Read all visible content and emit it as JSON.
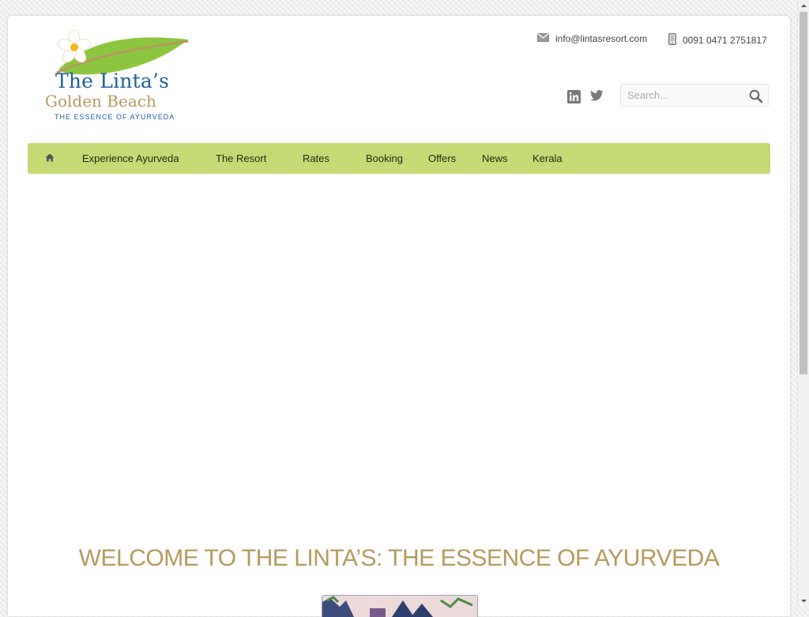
{
  "header": {
    "logo": {
      "line1": "The Linta’s",
      "line2": "Golden Beach",
      "line3": "THE ESSENCE OF AYURVEDA"
    },
    "contact": {
      "email": "info@lintasresort.com",
      "phone": "0091 0471 2751817"
    },
    "social": [
      "linkedin-icon",
      "twitter-icon"
    ],
    "search": {
      "placeholder": "Search..."
    }
  },
  "nav": {
    "home_icon": "home-icon",
    "items": [
      {
        "label": "Experience Ayurveda"
      },
      {
        "label": "The Resort"
      },
      {
        "label": "Rates"
      },
      {
        "label": "Booking"
      },
      {
        "label": "Offers"
      },
      {
        "label": "News"
      },
      {
        "label": "Kerala"
      }
    ]
  },
  "main": {
    "headline": "WELCOME TO THE LINTA’S: THE ESSENCE OF AYURVEDA"
  },
  "colors": {
    "nav_bg": "#c5da74",
    "headline": "#b49a5c",
    "logo_blue": "#1e5f9a",
    "logo_gold": "#b49b5c"
  }
}
